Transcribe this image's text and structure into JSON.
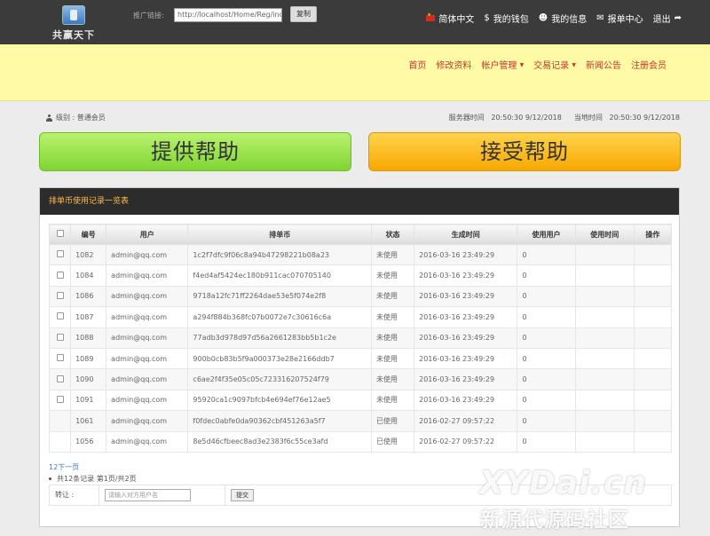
{
  "header": {
    "logo_text": "共赢天下",
    "promo_label": "推广链接:",
    "promo_link": "http://localhost/Home/Reg/index/u",
    "copy_label": "复制",
    "nav": [
      {
        "label": "简体中文",
        "icon": "china-flag-icon"
      },
      {
        "label": "我的钱包",
        "icon": "dollar-icon"
      },
      {
        "label": "我的信息",
        "icon": "user-icon"
      },
      {
        "label": "报单中心",
        "icon": "envelope-icon"
      },
      {
        "label": "退出",
        "icon": "share-arrow-icon"
      }
    ]
  },
  "main_nav": {
    "items": [
      "首页",
      "修改资料",
      "帐户管理",
      "交易记录",
      "新闻公告",
      "注册会员"
    ]
  },
  "info": {
    "level": "级别 : 普通会员",
    "server_time_label": "服务器时间",
    "server_time": "20:50:30 9/12/2018",
    "local_time_label": "当地时间",
    "local_time": "20:50:30 9/12/2018"
  },
  "buttons": {
    "provide_help": "提供帮助",
    "accept_help": "接受帮助"
  },
  "panel": {
    "title": "排单币使用记录一览表",
    "columns": [
      "编号",
      "用户",
      "排单币",
      "状态",
      "生成时间",
      "使用用户",
      "使用时间",
      "操作"
    ],
    "rows": [
      {
        "id": "1082",
        "user": "admin@qq.com",
        "coin": "1c2f7dfc9f06c8a94b47298221b08a23",
        "status": "未使用",
        "created": "2016-03-16 23:49:29",
        "used_by": "0",
        "has_check": true
      },
      {
        "id": "1084",
        "user": "admin@qq.com",
        "coin": "f4ed4af5424ec180b911cac070705140",
        "status": "未使用",
        "created": "2016-03-16 23:49:29",
        "used_by": "0",
        "has_check": true
      },
      {
        "id": "1086",
        "user": "admin@qq.com",
        "coin": "9718a12fc71ff2264dae53e5f074e2f8",
        "status": "未使用",
        "created": "2016-03-16 23:49:29",
        "used_by": "0",
        "has_check": true
      },
      {
        "id": "1087",
        "user": "admin@qq.com",
        "coin": "a294f884b368fc07b0072e7c30616c6a",
        "status": "未使用",
        "created": "2016-03-16 23:49:29",
        "used_by": "0",
        "has_check": true
      },
      {
        "id": "1088",
        "user": "admin@qq.com",
        "coin": "77adb3d978d97d56a2661283bb5b1c2e",
        "status": "未使用",
        "created": "2016-03-16 23:49:29",
        "used_by": "0",
        "has_check": true
      },
      {
        "id": "1089",
        "user": "admin@qq.com",
        "coin": "900b0cb83b5f9a000373e28e2166ddb7",
        "status": "未使用",
        "created": "2016-03-16 23:49:29",
        "used_by": "0",
        "has_check": true
      },
      {
        "id": "1090",
        "user": "admin@qq.com",
        "coin": "c6ae2f4f35e05c05c723316207524f79",
        "status": "未使用",
        "created": "2016-03-16 23:49:29",
        "used_by": "0",
        "has_check": true
      },
      {
        "id": "1091",
        "user": "admin@qq.com",
        "coin": "95920ca1c9097bfcb4e694ef76e12ae5",
        "status": "未使用",
        "created": "2016-03-16 23:49:29",
        "used_by": "0",
        "has_check": true
      },
      {
        "id": "1061",
        "user": "admin@qq.com",
        "coin": "f0fdec0abfe0da90362cbf451263a5f7",
        "status": "已使用",
        "created": "2016-02-27 09:57:22",
        "used_by": "0",
        "has_check": false
      },
      {
        "id": "1056",
        "user": "admin@qq.com",
        "coin": "8e5d46cfbeec8ad3e2383f6c55ce3afd",
        "status": "已使用",
        "created": "2016-02-27 09:57:22",
        "used_by": "0",
        "has_check": false
      }
    ],
    "pager": "12下一页",
    "total": "共12条记录 第1页/共2页",
    "transfer_label": "转让 :",
    "transfer_placeholder": "请输入对方用户名",
    "submit_label": "提交"
  },
  "watermark": {
    "line1": "XYDai.cn",
    "line2": "新源代源码社区"
  }
}
